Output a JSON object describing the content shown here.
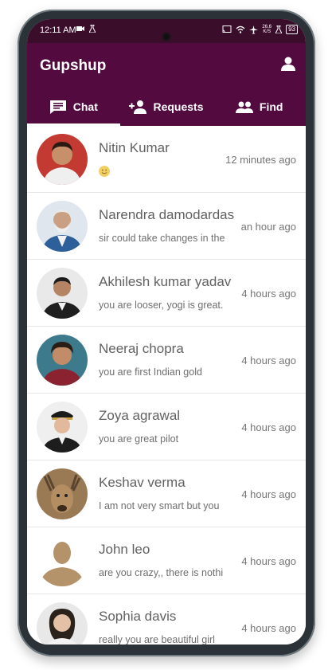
{
  "status_bar": {
    "time": "12:11 AM",
    "net_speed_value": "26.6",
    "net_speed_unit": "K/S",
    "battery": "93"
  },
  "app": {
    "title": "Gupshup",
    "colors": {
      "primary": "#520a3f",
      "statusbar": "#3a0d2b"
    }
  },
  "tabs": [
    {
      "label": "Chat",
      "icon": "chat-icon",
      "active": true
    },
    {
      "label": "Requests",
      "icon": "add-person-icon",
      "active": false
    },
    {
      "label": "Find",
      "icon": "people-icon",
      "active": false
    }
  ],
  "chats": [
    {
      "name": "Nitin Kumar",
      "message": "🙂",
      "time": "12 minutes ago"
    },
    {
      "name": "Narendra damodardas",
      "message": "sir could take changes in the",
      "time": "an hour ago"
    },
    {
      "name": "Akhilesh kumar yadav",
      "message": "you are looser, yogi is great.",
      "time": "4 hours ago"
    },
    {
      "name": "Neeraj chopra",
      "message": "you are first Indian gold",
      "time": "4 hours ago"
    },
    {
      "name": "Zoya agrawal",
      "message": "you are great pilot",
      "time": "4 hours ago"
    },
    {
      "name": "Keshav verma",
      "message": "I am not very smart but you",
      "time": "4 hours ago"
    },
    {
      "name": "John leo",
      "message": "are you crazy,, there is nothi",
      "time": "4 hours ago"
    },
    {
      "name": "Sophia davis",
      "message": "really you are beautiful girl",
      "time": "4 hours ago"
    }
  ]
}
